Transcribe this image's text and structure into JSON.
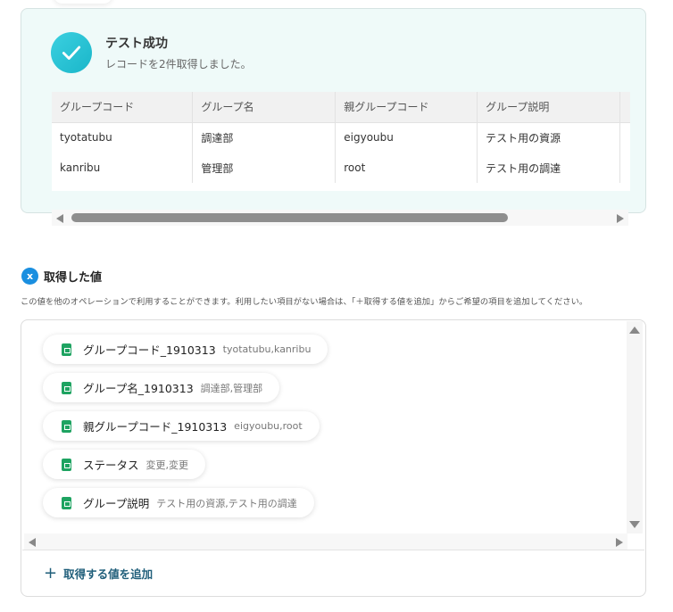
{
  "result": {
    "title": "テスト成功",
    "subtitle": "レコードを2件取得しました。"
  },
  "table": {
    "columns": [
      "グループコード",
      "グループ名",
      "親グループコード",
      "グループ説明",
      ""
    ],
    "rows": [
      [
        "tyotatubu",
        "調達部",
        "eigyoubu",
        "テスト用の資源",
        ""
      ],
      [
        "kanribu",
        "管理部",
        "root",
        "テスト用の調達",
        ""
      ]
    ]
  },
  "values_section": {
    "icon": "x-badge-icon",
    "title": "取得した値",
    "description": "この値を他のオペレーションで利用することができます。利用したい項目がない場合は、「＋取得する値を追加」からご希望の項目を追加してください。",
    "items": [
      {
        "name": "グループコード_1910313",
        "value": "tyotatubu,kanribu"
      },
      {
        "name": "グループ名_1910313",
        "value": "調達部,管理部"
      },
      {
        "name": "親グループコード_1910313",
        "value": "eigyoubu,root"
      },
      {
        "name": "ステータス",
        "value": "変更,変更"
      },
      {
        "name": "グループ説明",
        "value": "テスト用の資源,テスト用の調達"
      }
    ],
    "add_label": "取得する値を追加"
  },
  "colors": {
    "accent": "#1ab6c9",
    "sheet_green": "#1ea361",
    "link": "#1f5e7a"
  }
}
